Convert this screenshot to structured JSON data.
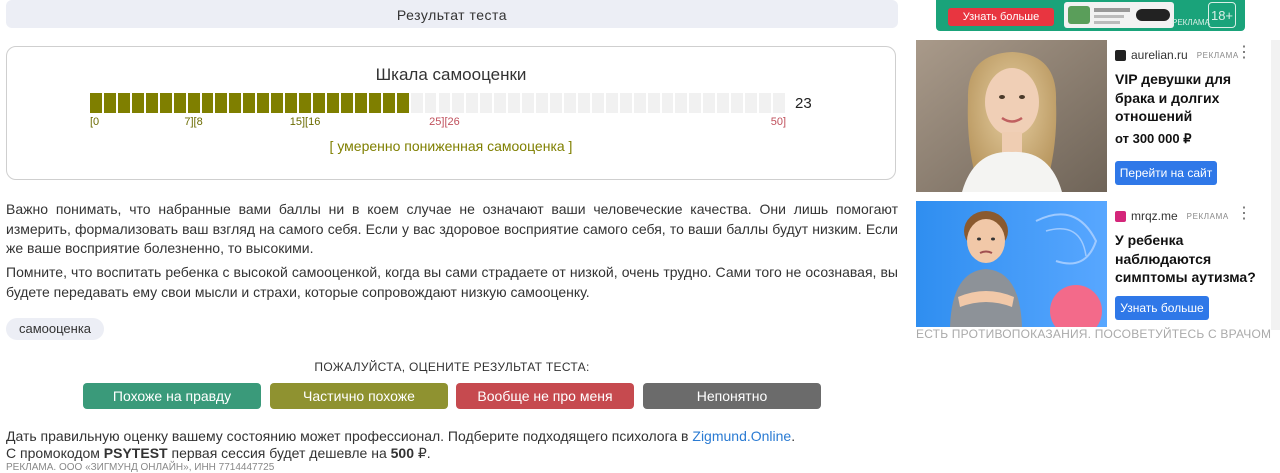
{
  "result": {
    "header": "Результат теста",
    "scale_title": "Шкала самооценки",
    "score_text": "23",
    "score_value": 23,
    "scale_max": 50,
    "scale_segments": 50,
    "filled_segments": 23,
    "ticks": [
      {
        "label": "[0",
        "value": 0,
        "color": "green"
      },
      {
        "label": "7][8",
        "value": 7.5,
        "color": "green"
      },
      {
        "label": "15][16",
        "value": 15.5,
        "color": "green"
      },
      {
        "label": "25][26",
        "value": 25.5,
        "color": "red"
      },
      {
        "label": "50]",
        "value": 50,
        "color": "red"
      }
    ],
    "verdict": "[ умеренно пониженная самооценка ]",
    "colors": {
      "filled": "#7f7f00",
      "empty": "#f1f1f1",
      "tick_green": "#6b6b00",
      "tick_red": "#c0505c"
    }
  },
  "paragraphs": [
    "Важно понимать, что набранные вами баллы ни в коем случае не означают ваши человеческие качества. Они лишь помогают измерить, формализовать ваш взгляд на самого себя. Если у вас здоровое восприятие самого себя, то ваши баллы будут низким. Если же ваше восприятие болезненно, то высокими.",
    "Помните, что воспитать ребенка с высокой самооценкой, когда вы сами страдаете от низкой, очень трудно. Сами того не осознавая, вы будете передавать ему свои мысли и страхи, которые сопровождают низкую самооценку."
  ],
  "tag": "самооценка",
  "rating": {
    "prompt": "ПОЖАЛУЙСТА, ОЦЕНИТЕ РЕЗУЛЬТАТ ТЕСТА:",
    "buttons": [
      {
        "label": "Похоже на правду",
        "color": "#3a9a7a"
      },
      {
        "label": "Частично похоже",
        "color": "#8f9230"
      },
      {
        "label": "Вообще не про меня",
        "color": "#c64a4f"
      },
      {
        "label": "Непонятно",
        "color": "#6b6b6b"
      }
    ]
  },
  "footer": {
    "line1_text": "Дать правильную оценку вашему состоянию может профессионал. Подберите подходящего психолога в ",
    "line1_link": "Zigmund.Online",
    "line1_end": ".",
    "line2_a": "С промокодом ",
    "line2_code": "PSYTEST",
    "line2_b": " первая сессия будет дешевле на ",
    "line2_price": "500",
    "line2_c": " ₽.",
    "cut_line": "РЕКЛАМА. ООО «ЗИГМУНД ОНЛАЙН», ИНН 7714447725"
  },
  "ads": {
    "top_banner": {
      "button": "Узнать больше",
      "label": "РЕКЛАМА",
      "age": "18+"
    },
    "card1": {
      "domain": "aurelian.ru",
      "label": "РЕКЛАМА",
      "title": "VIP девушки для брака и долгих отношений",
      "subtitle": "от 300 000 ₽",
      "button": "Перейти на сайт",
      "icon_color": "#222222"
    },
    "card2": {
      "domain": "mrqz.me",
      "label": "РЕКЛАМА",
      "title": "У ребенка наблюдаются симптомы аутизма?",
      "button": "Узнать больше",
      "icon_color": "#d4267a"
    },
    "disclaimer": "ЕСТЬ ПРОТИВОПОКАЗАНИЯ. ПОСОВЕТУЙТЕСЬ С ВРАЧОМ"
  }
}
